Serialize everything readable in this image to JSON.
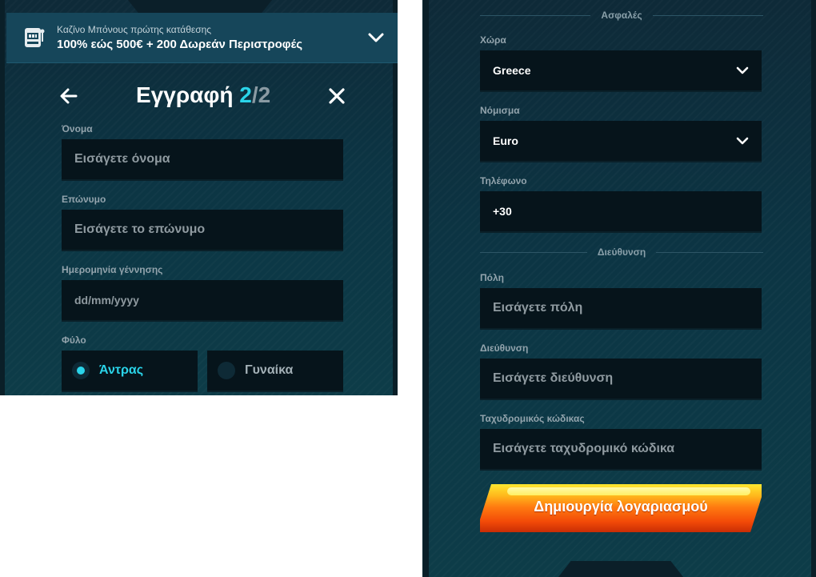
{
  "promo": {
    "subtitle": "Καζίνο Μπόνους πρώτης κατάθεσης",
    "title": "100% εώς 500€ + 200 Δωρεάν Περιστροφές",
    "icon": "slot-machine-icon",
    "toggle_icon": "chevron-down-icon"
  },
  "header": {
    "title": "Εγγραφή",
    "step_current": "2",
    "step_separator": "/",
    "step_total": "2",
    "back_icon": "arrow-left-icon",
    "close_icon": "close-icon"
  },
  "left_form": {
    "first_name": {
      "label": "Όνομα",
      "placeholder": "Εισάγετε όνομα"
    },
    "last_name": {
      "label": "Επώνυμο",
      "placeholder": "Εισάγετε το επώνυμο"
    },
    "birth_date": {
      "label": "Ημερομηνία γέννησης",
      "placeholder": "dd/mm/yyyy"
    },
    "gender": {
      "label": "Φύλο",
      "options": [
        {
          "label": "Άντρας",
          "selected": true
        },
        {
          "label": "Γυναίκα",
          "selected": false
        }
      ]
    }
  },
  "right_form": {
    "section_safety": "Ασφαλές",
    "country": {
      "label": "Χώρα",
      "value": "Greece"
    },
    "currency": {
      "label": "Νόμισμα",
      "value": "Euro"
    },
    "phone": {
      "label": "Τηλέφωνο",
      "value": "+30"
    },
    "section_address": "Διεύθυνση",
    "city": {
      "label": "Πόλη",
      "placeholder": "Εισάγετε πόλη"
    },
    "address": {
      "label": "Διεύθυνση",
      "placeholder": "Εισάγετε διεύθυνση"
    },
    "postal_code": {
      "label": "Ταχυδρομικός κώδικας",
      "placeholder": "Εισάγετε ταχυδρομικό κώδικα"
    },
    "submit_label": "Δημιουργία λογαριασμού"
  },
  "colors": {
    "accent": "#2ad4e9",
    "field_bg": "#06141b",
    "panel_bg": "#0c3544",
    "cta_start": "#ffe830",
    "cta_end": "#c92d05"
  }
}
